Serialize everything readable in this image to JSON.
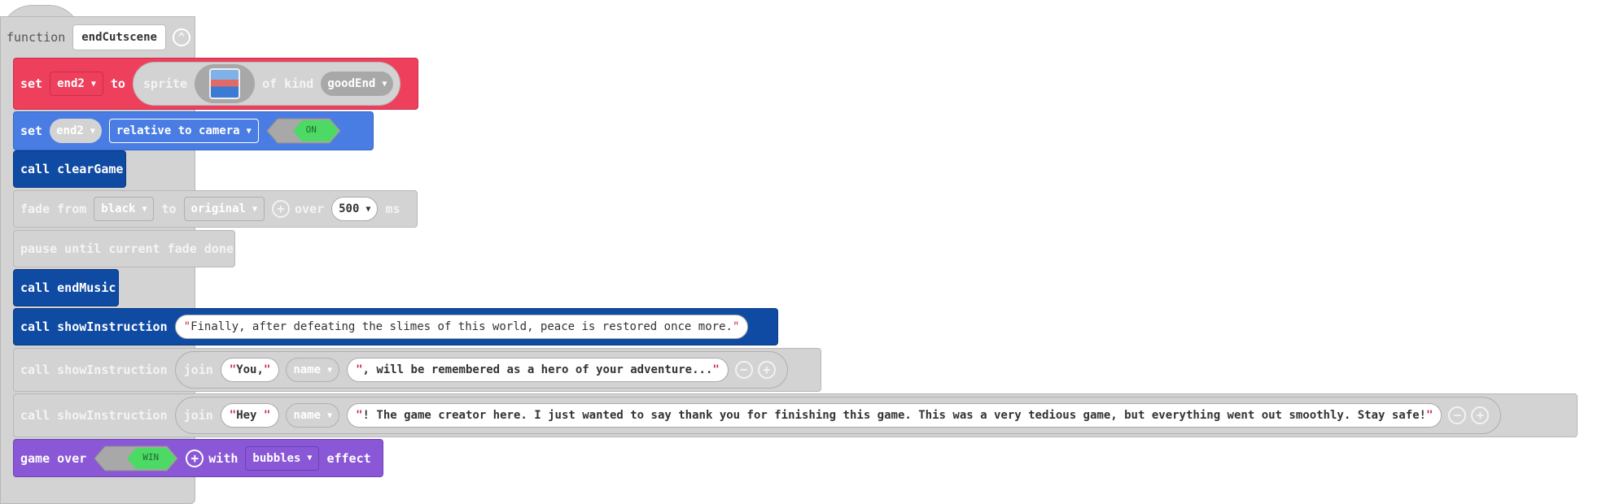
{
  "function": {
    "keyword": "function",
    "name": "endCutscene",
    "collapse_icon": "chevron-up-icon"
  },
  "rows": {
    "set_sprite": {
      "set": "set",
      "var": "end2",
      "to": "to",
      "sprite": "sprite",
      "of_kind": "of kind",
      "kind": "goodEnd"
    },
    "set_relative": {
      "set": "set",
      "var": "end2",
      "property": "relative to camera",
      "toggle": "ON"
    },
    "clear_game": {
      "label": "call clearGame"
    },
    "fade": {
      "fade_from": "fade from",
      "from": "black",
      "to": "to",
      "to_value": "original",
      "over": "over",
      "ms_value": "500",
      "ms": "ms"
    },
    "pause": {
      "label": "pause until current fade done"
    },
    "end_music": {
      "label": "call endMusic"
    },
    "show1": {
      "label": "call showInstruction",
      "text": "Finally, after defeating the slimes of this world, peace is restored once more."
    },
    "show2": {
      "label": "call showInstruction",
      "join": "join",
      "part1": "You,",
      "name": "name",
      "part2": ", will be remembered as a hero of your adventure..."
    },
    "show3": {
      "label": "call showInstruction",
      "join": "join",
      "part1": "Hey ",
      "name": "name",
      "part2": "! The game creator here. I just wanted to say thank you for finishing this game. This was a very tedious game, but everything went out smoothly. Stay safe!"
    },
    "game_over": {
      "game_over": "game over",
      "toggle": "WIN",
      "with": "with",
      "effect_value": "bubbles",
      "effect": "effect"
    }
  },
  "colors": {
    "grey": "#d3d3d3",
    "red": "#ee3f5d",
    "blue": "#4a7de4",
    "dark_blue": "#0f4aa3",
    "purple": "#8a58d6",
    "toggle_green": "#4cd964"
  }
}
